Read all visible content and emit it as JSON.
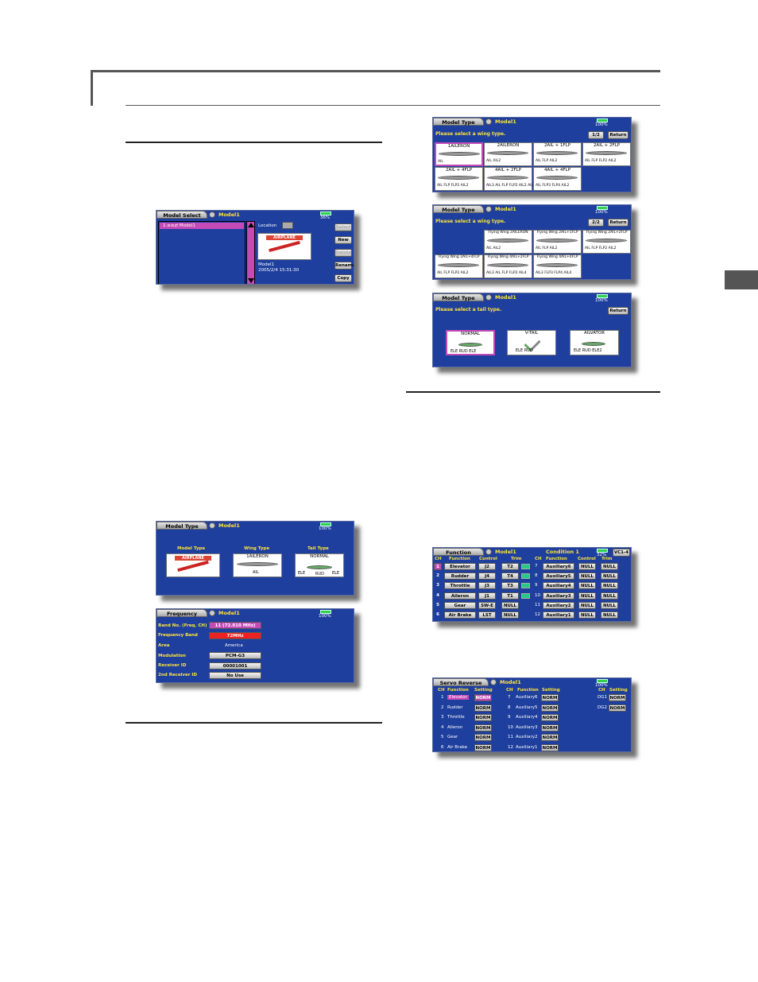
{
  "page": {
    "side_tab_color": "#555555"
  },
  "model_select": {
    "tab": "Model Select",
    "model": "Model1",
    "battery": "36%",
    "list_item": "1.≡≡⇄ Model1",
    "location_label": "Location",
    "card_banner": "AIRPLANE",
    "card_name": "Model1",
    "card_date": "2005/2/4   15:31:30",
    "buttons": [
      "Select",
      "New",
      "Delete",
      "Rename",
      "Copy"
    ]
  },
  "model_type": {
    "tab": "Model Type",
    "model": "Model1",
    "battery": "100%",
    "headers": [
      "Model Type",
      "Wing Type",
      "Tail Type"
    ],
    "airplane": "AIRPLANE",
    "wing": "1AILERON",
    "wing_ail": "AIL",
    "tail": "NORMAL",
    "tail_labels": [
      "ELE",
      "RUD",
      "ELE"
    ]
  },
  "frequency": {
    "tab": "Frequency",
    "model": "Model1",
    "battery": "100%",
    "labels": [
      "Band No. (Freq. CH)",
      "Frequency Band",
      "Area",
      "Modulation",
      "Receiver ID",
      "2nd Receiver ID"
    ],
    "values": [
      "11 (72.010 MHz)",
      "72MHz",
      "America",
      "PCM-G3",
      "00001001",
      "No Use"
    ]
  },
  "wing1": {
    "tab": "Model Type",
    "model": "Model1",
    "battery": "100%",
    "prompt": "Please select a wing type.",
    "page": "1/2",
    "return": "Return",
    "cells": [
      {
        "title": "1AILERON",
        "bottom": "AIL"
      },
      {
        "title": "2AILERON",
        "bottom": "AIL   AIL2"
      },
      {
        "title": "2AIL + 1FLP",
        "bottom": "AIL  FLP  AIL2"
      },
      {
        "title": "2AIL + 2FLP",
        "bottom": "AIL FLP FLP2 AIL2"
      },
      {
        "title": "2AIL + 4FLP",
        "bottom": "AIL  FLP FLP2 AIL2"
      },
      {
        "title": "4AIL + 2FLP",
        "bottom": "AIL3 AIL FLP FLP2 AIL2 AIL4"
      },
      {
        "title": "4AIL + 4FLP",
        "bottom": "AIL FLP3 FLP4 AIL2"
      }
    ]
  },
  "wing2": {
    "tab": "Model Type",
    "model": "Model1",
    "battery": "100%",
    "prompt": "Please select a wing type.",
    "page": "2/2",
    "return": "Return",
    "cells": [
      {
        "title": "Flying Wing   2AILERON",
        "bottom": "AIL   AIL2"
      },
      {
        "title": "Flying Wing   2AIL+1FLP",
        "bottom": "AIL  FLP  AIL2"
      },
      {
        "title": "Flying Wing   2AIL+2FLP",
        "bottom": "AIL FLP FLP2 AIL2"
      },
      {
        "title": "Flying Wing   2AIL+4FLP",
        "bottom": "AIL FLP FLP2 AIL2"
      },
      {
        "title": "Flying Wing   4AIL+2FLP",
        "bottom": "AIL3 AIL FLP FLP2 AIL4"
      },
      {
        "title": "Flying Wing   4AIL+4FLP",
        "bottom": "AIL3 FLP3 FLP4 AIL4"
      }
    ]
  },
  "tail": {
    "tab": "Model Type",
    "model": "Model1",
    "battery": "100%",
    "prompt": "Please select a tail type.",
    "return": "Return",
    "cells": [
      {
        "title": "NORMAL",
        "bottom": "ELE  RUD  ELE"
      },
      {
        "title": "V-TAIL",
        "bottom": "ELE   RUD"
      },
      {
        "title": "AILVATOR",
        "bottom": "ELE  RUD  ELE2"
      }
    ]
  },
  "function": {
    "tab": "Function",
    "model": "Model1",
    "condition": "Condition 1",
    "battery": "32%",
    "vc": "VC1-4",
    "headers": [
      "CH",
      "Function",
      "Control",
      "Trim",
      "CH",
      "Function",
      "Control",
      "Trim"
    ],
    "left": [
      [
        "1",
        "Elevator",
        "J2",
        "T2"
      ],
      [
        "2",
        "Rudder",
        "J4",
        "T4"
      ],
      [
        "3",
        "Throttle",
        "J3",
        "T3"
      ],
      [
        "4",
        "Aileron",
        "J1",
        "T1"
      ],
      [
        "5",
        "Gear",
        "SW-E",
        "NULL"
      ],
      [
        "6",
        "Air Brake",
        "LST",
        "NULL"
      ]
    ],
    "right": [
      [
        "7",
        "Auxiliary6",
        "NULL",
        "NULL"
      ],
      [
        "8",
        "Auxiliary5",
        "NULL",
        "NULL"
      ],
      [
        "9",
        "Auxiliary4",
        "NULL",
        "NULL"
      ],
      [
        "10",
        "Auxiliary3",
        "NULL",
        "NULL"
      ],
      [
        "11",
        "Auxiliary2",
        "NULL",
        "NULL"
      ],
      [
        "12",
        "Auxiliary1",
        "NULL",
        "NULL"
      ]
    ]
  },
  "servo": {
    "tab": "Servo Reverse",
    "model": "Model1",
    "battery": "100%",
    "headers": [
      "CH",
      "Function",
      "Setting",
      "CH",
      "Function",
      "Setting",
      "CH",
      "Setting"
    ],
    "col1": [
      [
        "1",
        "Elevator",
        "NORM"
      ],
      [
        "2",
        "Rudder",
        "NORM"
      ],
      [
        "3",
        "Throttle",
        "NORM"
      ],
      [
        "4",
        "Aileron",
        "NORM"
      ],
      [
        "5",
        "Gear",
        "NORM"
      ],
      [
        "6",
        "Air Brake",
        "NORM"
      ]
    ],
    "col2": [
      [
        "7",
        "Auxiliary6",
        "NORM"
      ],
      [
        "8",
        "Auxiliary5",
        "NORM"
      ],
      [
        "9",
        "Auxiliary4",
        "NORM"
      ],
      [
        "10",
        "Auxiliary3",
        "NORM"
      ],
      [
        "11",
        "Auxiliary2",
        "NORM"
      ],
      [
        "12",
        "Auxiliary1",
        "NORM"
      ]
    ],
    "col3": [
      [
        "DG1",
        "NORM"
      ],
      [
        "DG2",
        "NORM"
      ]
    ]
  }
}
